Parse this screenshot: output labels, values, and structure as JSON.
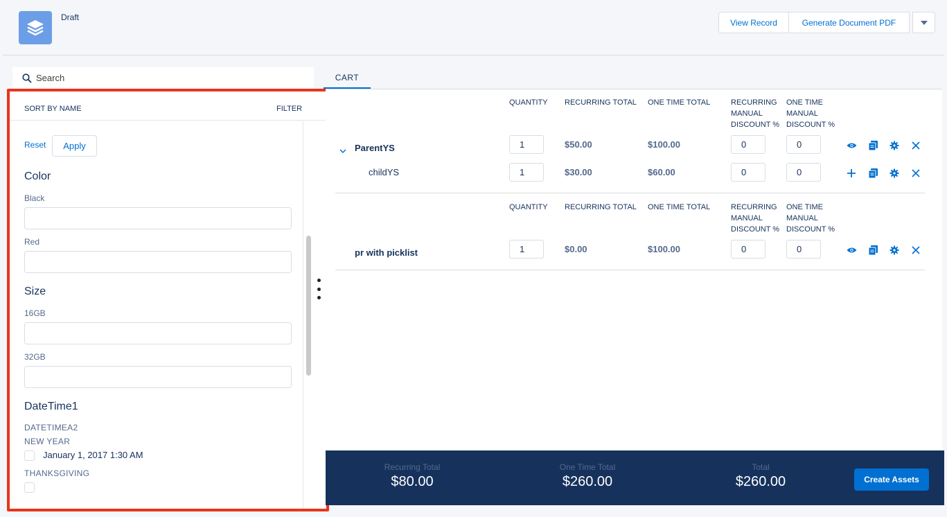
{
  "header": {
    "status": "Draft",
    "buttons": {
      "view_record": "View Record",
      "generate_pdf": "Generate Document PDF"
    }
  },
  "search": {
    "placeholder": "Search"
  },
  "filter_panel": {
    "sort_label": "SORT BY NAME",
    "filter_label": "FILTER",
    "reset": "Reset",
    "apply": "Apply",
    "groups": [
      {
        "title": "Color",
        "fields": [
          "Black",
          "Red"
        ]
      },
      {
        "title": "Size",
        "fields": [
          "16GB",
          "32GB"
        ]
      },
      {
        "title": "DateTime1",
        "sub_label": "DATETIMEA2",
        "options": [
          {
            "label": "NEW YEAR",
            "value": "January 1, 2017 1:30 AM",
            "checked": false
          },
          {
            "label": "THANKSGIVING",
            "value": "",
            "checked": false
          }
        ]
      }
    ]
  },
  "cart": {
    "tab": "CART",
    "columns": {
      "quantity": "QUANTITY",
      "recurring_total": "RECURRING TOTAL",
      "one_time_total": "ONE TIME TOTAL",
      "recurring_discount": [
        "RECURRING",
        "MANUAL",
        "DISCOUNT %"
      ],
      "one_time_discount": [
        "ONE TIME",
        "MANUAL",
        "DISCOUNT %"
      ]
    },
    "groups": [
      {
        "rows": [
          {
            "name": "ParentYS",
            "quantity": "1",
            "recurring": "$50.00",
            "one_time": "$100.00",
            "rec_disc": "0",
            "ot_disc": "0",
            "expanded": true,
            "icons": [
              "eye-icon",
              "copy-icon",
              "gear-icon",
              "close-icon"
            ]
          },
          {
            "name": "childYS",
            "quantity": "1",
            "recurring": "$30.00",
            "one_time": "$60.00",
            "rec_disc": "0",
            "ot_disc": "0",
            "icons": [
              "plus-icon",
              "copy-icon",
              "gear-icon",
              "close-icon"
            ]
          }
        ]
      },
      {
        "rows": [
          {
            "name": "pr with picklist",
            "quantity": "1",
            "recurring": "$0.00",
            "one_time": "$100.00",
            "rec_disc": "0",
            "ot_disc": "0",
            "icons": [
              "eye-icon",
              "copy-icon",
              "gear-icon",
              "close-icon"
            ]
          }
        ]
      }
    ]
  },
  "footer": {
    "recurring_label": "Recurring Total",
    "recurring_value": "$80.00",
    "one_time_label": "One Time Total",
    "one_time_value": "$260.00",
    "total_label": "Total",
    "total_value": "$260.00",
    "create_assets": "Create Assets"
  },
  "colors": {
    "accent": "#0070d2",
    "footer_bg": "#16325c",
    "highlight_border": "#e8341c"
  }
}
